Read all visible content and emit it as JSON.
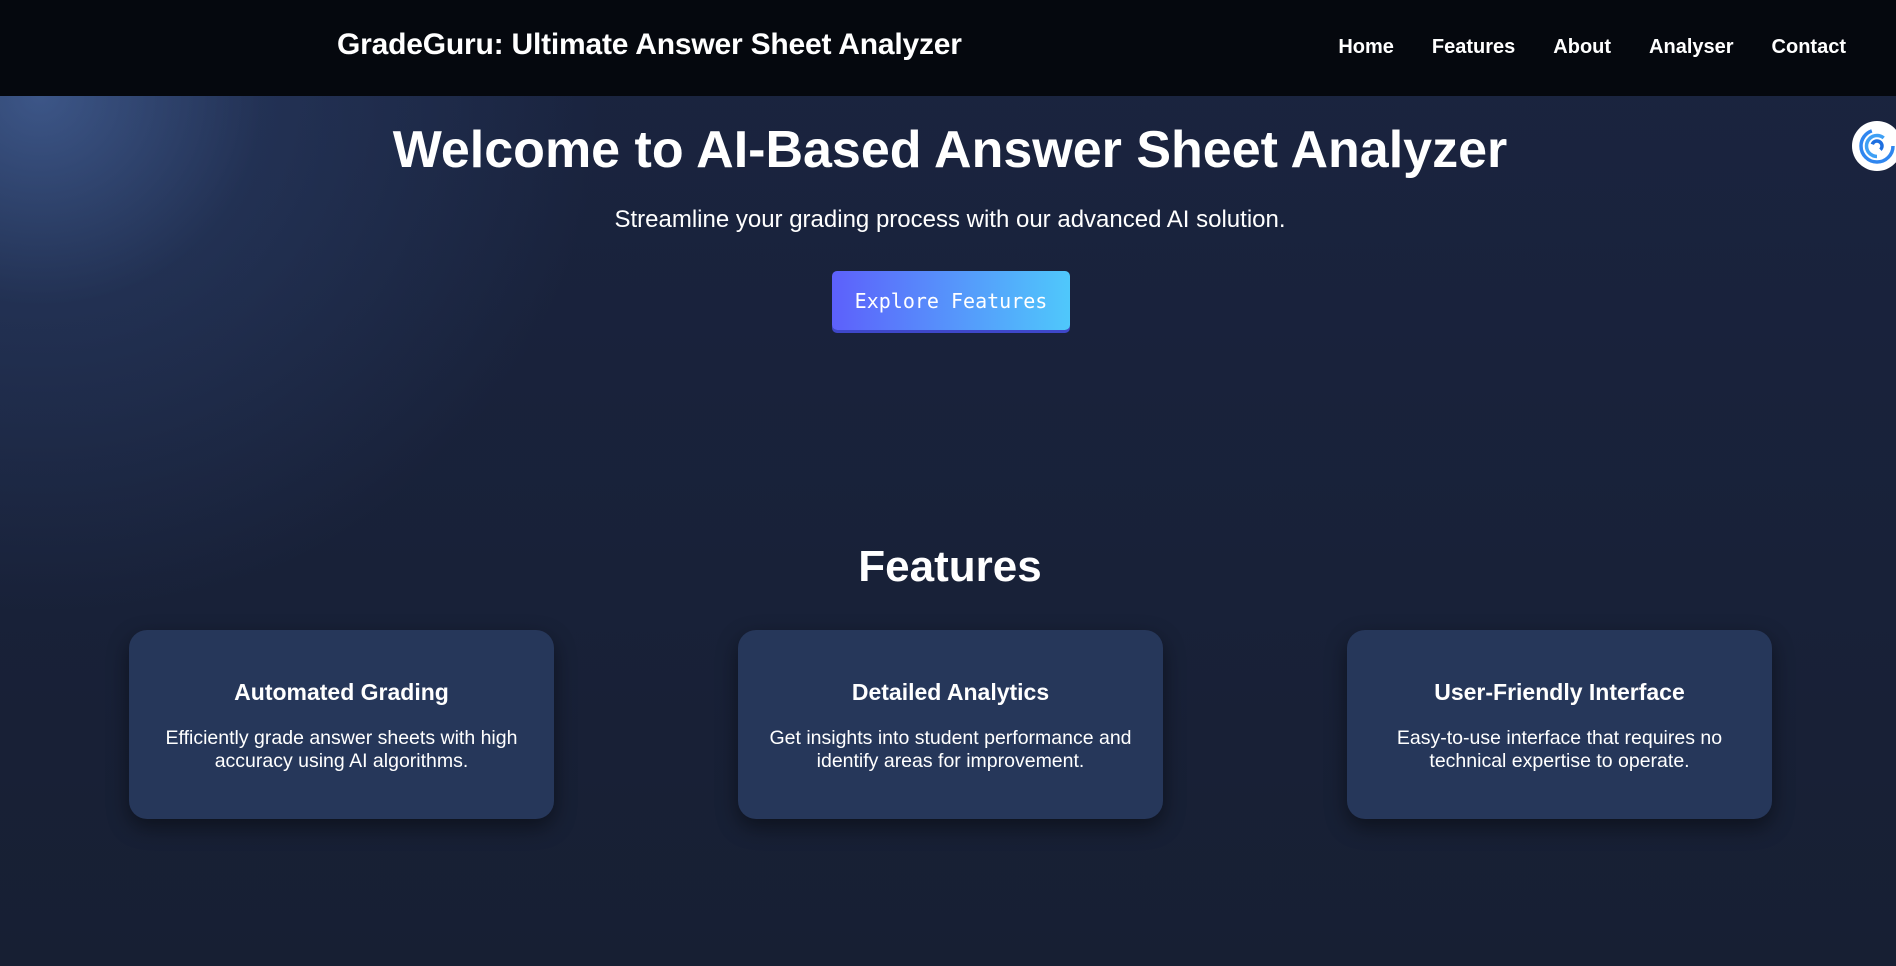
{
  "brand": {
    "title": "GradeGuru: Ultimate Answer Sheet Analyzer"
  },
  "nav": {
    "links": [
      "Home",
      "Features",
      "About",
      "Analyser",
      "Contact"
    ]
  },
  "hero": {
    "title": "Welcome to AI-Based Answer Sheet Analyzer",
    "subtitle": "Streamline your grading process with our advanced AI solution.",
    "cta_label": "Explore Features"
  },
  "features": {
    "heading": "Features",
    "cards": [
      {
        "title": "Automated Grading",
        "description": "Efficiently grade answer sheets with high accuracy using AI algorithms."
      },
      {
        "title": "Detailed Analytics",
        "description": "Get insights into student performance and identify areas for improvement."
      },
      {
        "title": "User-Friendly Interface",
        "description": "Easy-to-use interface that requires no technical expertise to operate."
      }
    ]
  },
  "widgets": {
    "assistant_icon": "swirl-icon"
  },
  "colors": {
    "navbar": "#05080e",
    "background": "#171f33",
    "card": "#26375a",
    "cta_start": "#5d60fb",
    "cta_end": "#4fc8fb"
  }
}
